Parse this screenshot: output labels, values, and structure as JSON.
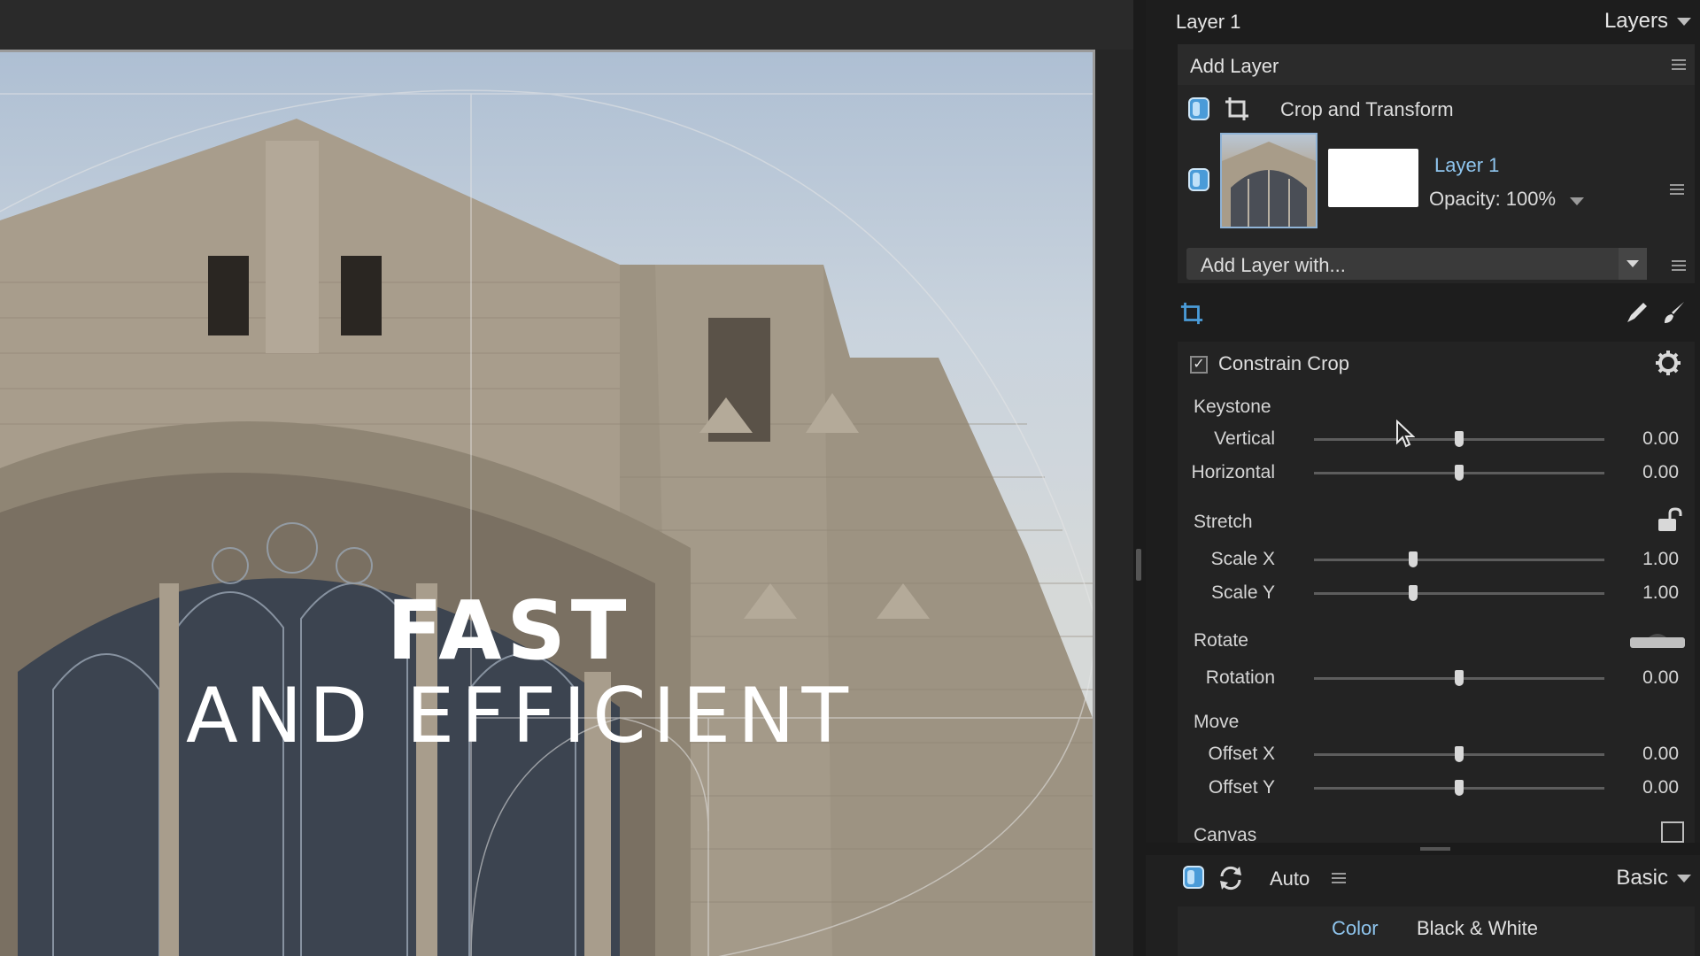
{
  "canvas": {
    "overlay_line1": "FAST",
    "overlay_line2": "AND EFFICIENT"
  },
  "panel_header": {
    "current_layer": "Layer 1",
    "menu_label": "Layers"
  },
  "layers": {
    "add_layer": "Add Layer",
    "crop_transform": "Crop and Transform",
    "layer_name": "Layer 1",
    "opacity": "Opacity: 100%",
    "add_layer_with": "Add Layer with..."
  },
  "crop": {
    "constrain_label": "Constrain Crop",
    "constrain_checked": true,
    "sections": {
      "keystone": "Keystone",
      "stretch": "Stretch",
      "rotate": "Rotate",
      "move": "Move",
      "canvas": "Canvas"
    },
    "sliders": {
      "vertical": {
        "label": "Vertical",
        "value": "0.00",
        "position": 0.5
      },
      "horizontal": {
        "label": "Horizontal",
        "value": "0.00",
        "position": 0.5
      },
      "scale_x": {
        "label": "Scale X",
        "value": "1.00",
        "position": 0.34
      },
      "scale_y": {
        "label": "Scale Y",
        "value": "1.00",
        "position": 0.34
      },
      "rotation": {
        "label": "Rotation",
        "value": "0.00",
        "position": 0.5
      },
      "offset_x": {
        "label": "Offset X",
        "value": "0.00",
        "position": 0.5
      },
      "offset_y": {
        "label": "Offset Y",
        "value": "0.00",
        "position": 0.5
      }
    }
  },
  "bottom": {
    "auto_label": "Auto",
    "preset_menu": "Basic",
    "tab_color": "Color",
    "tab_bw": "Black & White"
  },
  "colors": {
    "accent": "#4a9bd8",
    "active_tab": "#8fc5ee",
    "panel_bg": "#1d1d1d"
  },
  "icons": [
    "crop-icon",
    "hamburger-icon",
    "chevron-down-icon",
    "gear-icon",
    "lock-icon",
    "reset-icon",
    "brush-icon",
    "pencil-icon",
    "canvas-icon",
    "toggle-icon"
  ]
}
